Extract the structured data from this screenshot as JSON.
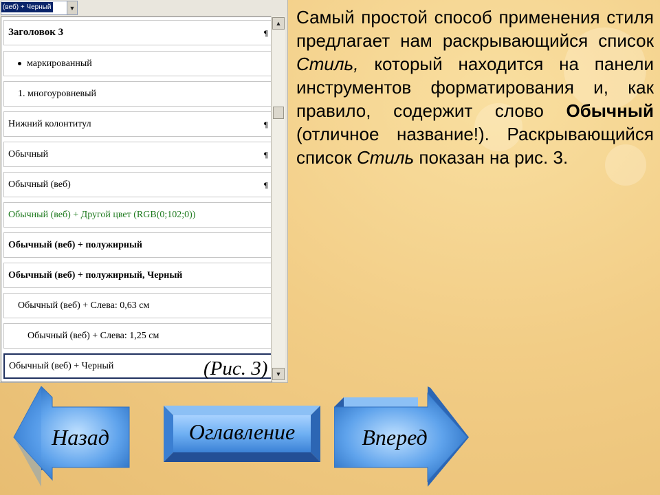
{
  "style_combo": {
    "value": "(веб) + Черный",
    "arrow_icon": "chevron-down-icon"
  },
  "style_list": {
    "items": [
      {
        "label": "Заголовок 3",
        "bold": true,
        "pilcrow": "¶"
      },
      {
        "label": "маркированный",
        "bullet": true
      },
      {
        "label": "1.  многоуровневый"
      },
      {
        "label": "Нижний колонтитул",
        "pilcrow": "¶"
      },
      {
        "label": "Обычный",
        "pilcrow": "¶"
      },
      {
        "label": "Обычный (веб)",
        "pilcrow": "¶"
      },
      {
        "label": "Обычный (веб) + Другой цвет (RGB(0;102;0))",
        "color": "#1e7a1e"
      },
      {
        "label": "Обычный (веб) + полужирный",
        "bold": true
      },
      {
        "label": "Обычный (веб) + полужирный, Черный",
        "bold": true
      },
      {
        "label": "Обычный (веб) + Слева:  0,63 см"
      },
      {
        "label": "Обычный (веб) + Слева:  1,25 см"
      },
      {
        "label": "Обычный (веб) + Черный",
        "selected": true
      }
    ]
  },
  "figure_caption": "(Рис. 3)",
  "paragraph": {
    "part1": "Самый простой способ применения стиля предлагает нам раскрывающийся список ",
    "em1": "Стиль,",
    "part2": " который находится на панели инструментов форматирования и, как правило, содержит слово ",
    "bold1": "Обычный",
    "part3": " (отличное название!). Раскрывающийся список ",
    "em2": "Стиль",
    "part4": " показан на рис. 3."
  },
  "navigation": {
    "back_label": "Назад",
    "toc_label": "Оглавление",
    "forward_label": "Вперед",
    "button_color": "#4a93e4"
  }
}
